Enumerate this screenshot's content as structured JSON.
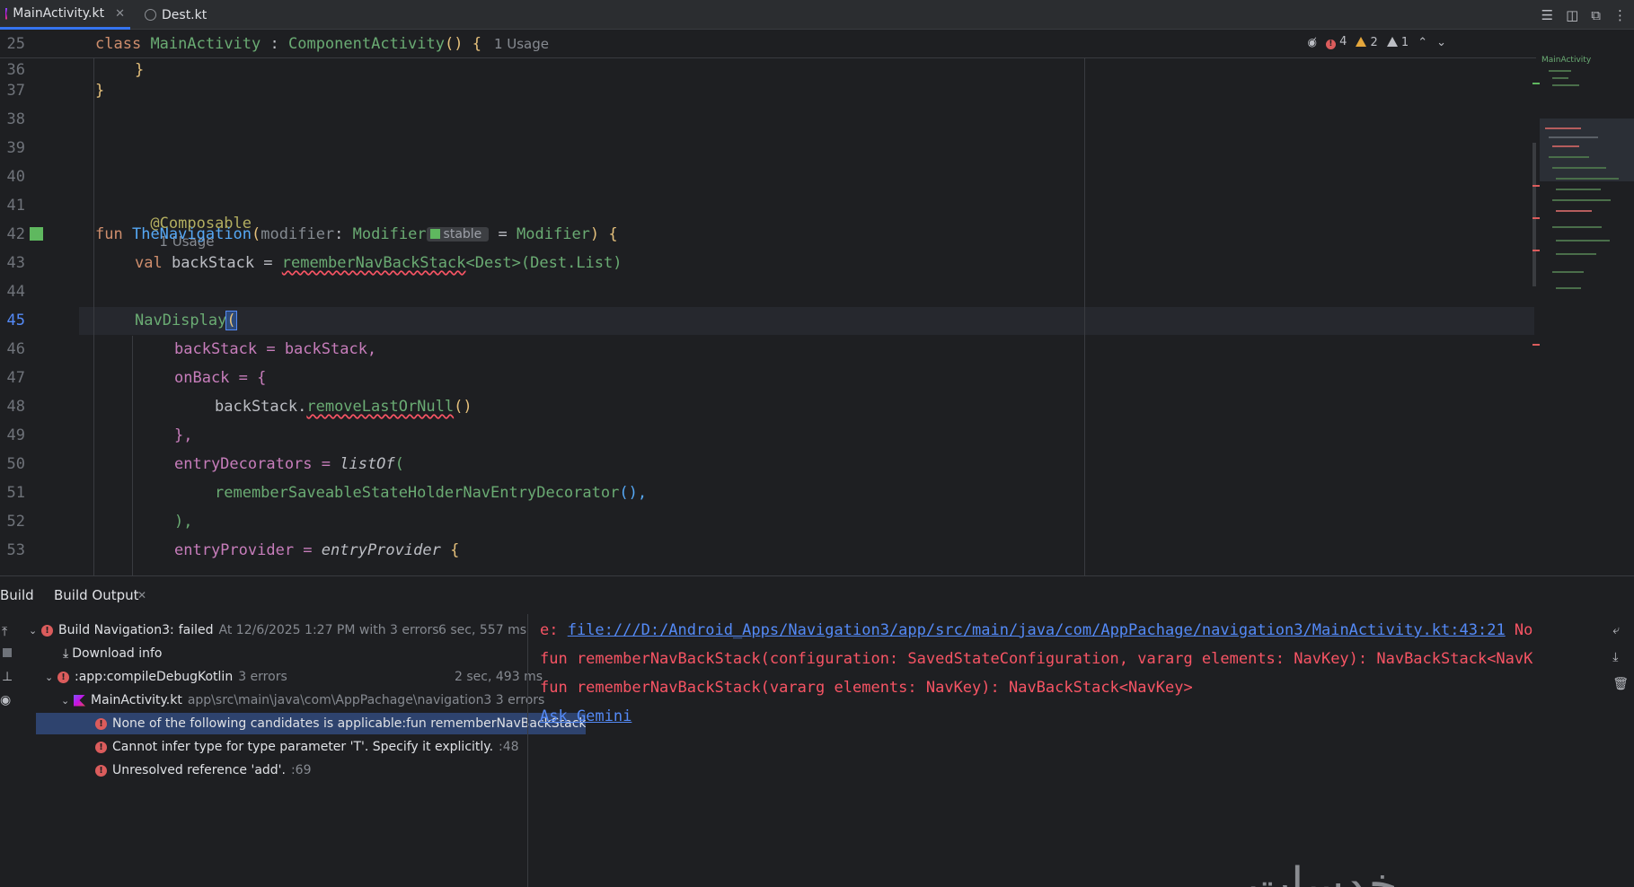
{
  "tabs": [
    {
      "label": "MainActivity.kt",
      "active": true
    },
    {
      "label": "Dest.kt",
      "active": false
    }
  ],
  "sticky": {
    "line": "25",
    "code_kw": "class",
    "code_cls": "MainActivity",
    "code_sep": " : ",
    "code_parent": "ComponentActivity",
    "code_tail": "() {",
    "usage": "1 Usage"
  },
  "inspections": {
    "errors": "4",
    "warnings": "2",
    "weak_warnings": "1"
  },
  "minimap_title": "MainActivity",
  "gutter": [
    "36",
    "37",
    "38",
    "39",
    "40",
    "41",
    "42",
    "43",
    "44",
    "45",
    "46",
    "47",
    "48",
    "49",
    "50",
    "51",
    "52",
    "53"
  ],
  "code": {
    "l36": "}",
    "l37": "}",
    "l41_ann": "@Composable",
    "l41_usage": "1 Usage",
    "l42_kw": "fun",
    "l42_fn": "TheNavigation",
    "l42_open": "(",
    "l42_param": "modifier",
    "l42_colon": ": ",
    "l42_type": "Modifier",
    "l42_stable": "stable",
    "l42_eq": " = ",
    "l42_default": "Modifier",
    "l42_close": ") {",
    "l43_kw": "val",
    "l43_name": " backStack = ",
    "l43_fn": "rememberNavBackStack",
    "l43_generic": "<Dest>",
    "l43_args": "(Dest.List)",
    "l45_fn": "NavDisplay",
    "l45_paren": "(",
    "l46": "backStack = backStack,",
    "l47": "onBack = {",
    "l48_obj": "backStack.",
    "l48_fn": "removeLastOrNull",
    "l48_tail": "()",
    "l49": "},",
    "l50_name": "entryDecorators = ",
    "l50_fn": "listOf",
    "l50_tail": "(",
    "l51_fn": "rememberSaveableStateHolderNavEntryDecorator",
    "l51_tail": "(),",
    "l52": "),",
    "l53_name": "entryProvider = ",
    "l53_fn": "entryProvider",
    "l53_tail": " {"
  },
  "build": {
    "tab_build": "Build",
    "tab_output": "Build Output",
    "tree": [
      {
        "label": "Build Navigation3:",
        "status": "failed",
        "detail": "At 12/6/2025 1:27 PM with 3 errors",
        "time": "6 sec, 557 ms"
      },
      {
        "label": "Download info"
      },
      {
        "label": ":app:compileDebugKotlin",
        "detail": "3 errors",
        "time": "2 sec, 493 ms"
      },
      {
        "label": "MainActivity.kt",
        "detail": "app\\src\\main\\java\\com\\AppPachage\\navigation3 3 errors"
      },
      {
        "label": "None of the following candidates is applicable:fun rememberNavBackStack"
      },
      {
        "label": "Cannot infer type for type parameter 'T'. Specify it explicitly.",
        "detail": ":48"
      },
      {
        "label": "Unresolved reference 'add'.",
        "detail": ":69"
      }
    ],
    "output": {
      "prefix": "e: ",
      "link": "file:///D:/Android_Apps/Navigation3/app/src/main/java/com/AppPachage/navigation3/MainActivity.kt:43:21",
      "suffix": " No",
      "line2": "fun rememberNavBackStack(configuration: SavedStateConfiguration, vararg elements: NavKey): NavBackStack<NavK",
      "line3": "fun rememberNavBackStack(vararg elements: NavKey): NavBackStack<NavKey>",
      "ask": "Ask Gemini"
    },
    "watermark": "خدسات"
  }
}
